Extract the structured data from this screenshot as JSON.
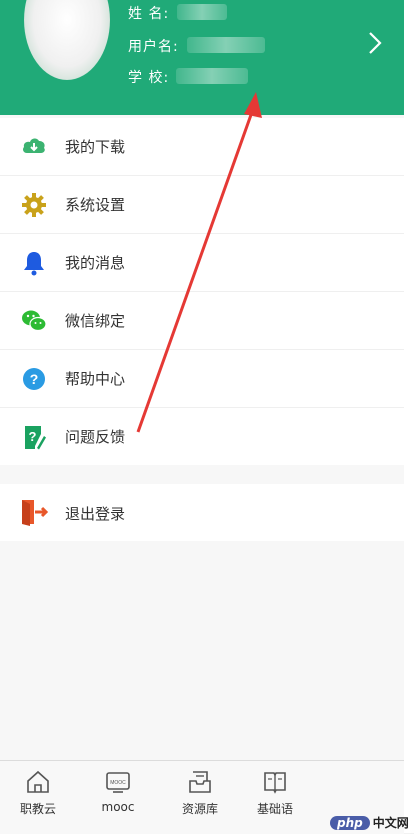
{
  "profile": {
    "name_label": "姓  名:",
    "username_label": "用户名:",
    "school_label": "学  校:"
  },
  "menu": [
    {
      "label": "我的下载",
      "icon": "cloud-download-icon",
      "color": "#3cb371"
    },
    {
      "label": "系统设置",
      "icon": "gear-icon",
      "color": "#c9a21b"
    },
    {
      "label": "我的消息",
      "icon": "bell-icon",
      "color": "#1e5be0"
    },
    {
      "label": "微信绑定",
      "icon": "wechat-icon",
      "color": "#2dbb34"
    },
    {
      "label": "帮助中心",
      "icon": "help-icon",
      "color": "#2a9be3"
    },
    {
      "label": "问题反馈",
      "icon": "feedback-icon",
      "color": "#1aa260"
    }
  ],
  "logout": {
    "label": "退出登录",
    "icon": "exit-icon",
    "color": "#e8572a"
  },
  "tabbar": [
    {
      "label": "职教云",
      "icon": "home-icon"
    },
    {
      "label": "mooc",
      "icon": "mooc-icon",
      "badge": "MOOC"
    },
    {
      "label": "资源库",
      "icon": "inbox-icon"
    },
    {
      "label": "基础语",
      "icon": "book-icon"
    }
  ],
  "watermark": {
    "php": "php",
    "cn": "中文网"
  },
  "colors": {
    "header": "#20aa78",
    "annotation_arrow": "#e53935"
  }
}
